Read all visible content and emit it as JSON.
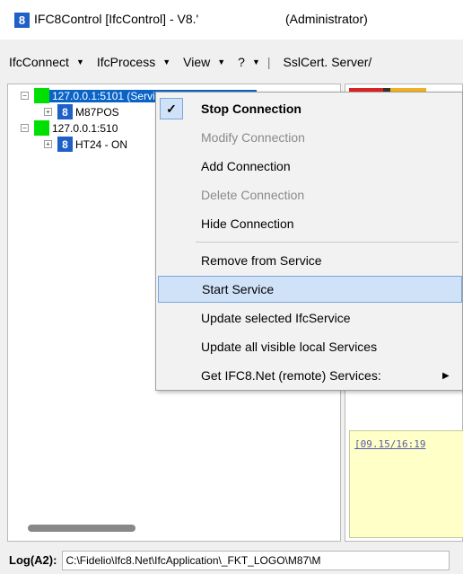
{
  "window": {
    "title": "IFC8Control [IfcControl] - V8.'",
    "admin": "(Administrator)",
    "icon_text": "8"
  },
  "menubar": [
    {
      "label": "IfcConnect",
      "arrow": "▼"
    },
    {
      "label": "IfcProcess",
      "arrow": "▼"
    },
    {
      "label": "View",
      "arrow": "▼"
    },
    {
      "label": "?",
      "arrow": "▼"
    },
    {
      "label": "SslCert. Server/",
      "arrow": ""
    }
  ],
  "tree": {
    "node1": "127.0.0.1:5101 (Service M87POS DEMO I",
    "node1_child": "M87POS",
    "node2": "127.0.0.1:510",
    "node2_child": "HT24 - ON"
  },
  "right_panel": {
    "log_entry": "[09.15/16:19",
    "strip_colors": [
      "#dd2222",
      "#333333",
      "#f0b020",
      "#ffffff"
    ]
  },
  "context_menu": {
    "items": [
      {
        "label": "Stop Connection",
        "state": "checked",
        "style": "bold"
      },
      {
        "label": "Modify Connection",
        "state": "disabled"
      },
      {
        "label": "Add Connection",
        "state": "enabled"
      },
      {
        "label": "Delete Connection",
        "state": "disabled"
      },
      {
        "label": "Hide Connection",
        "state": "enabled"
      },
      {
        "label": "Remove from Service",
        "state": "enabled"
      },
      {
        "label": "Start Service",
        "state": "highlighted"
      },
      {
        "label": "Update selected IfcService",
        "state": "enabled"
      },
      {
        "label": "Update all visible local Services",
        "state": "enabled"
      },
      {
        "label": "Get IFC8.Net (remote) Services:",
        "state": "submenu"
      }
    ],
    "check_glyph": "✓",
    "submenu_glyph": "▶"
  },
  "statusbar": {
    "label": "Log(A2):",
    "value": "C:\\Fidelio\\Ifc8.Net\\IfcApplication\\_FKT_LOGO\\M87\\M"
  },
  "colors": {
    "accent": "#0a64c8",
    "status_green": "#00e000",
    "menu_highlight": "#cfe2f7"
  }
}
